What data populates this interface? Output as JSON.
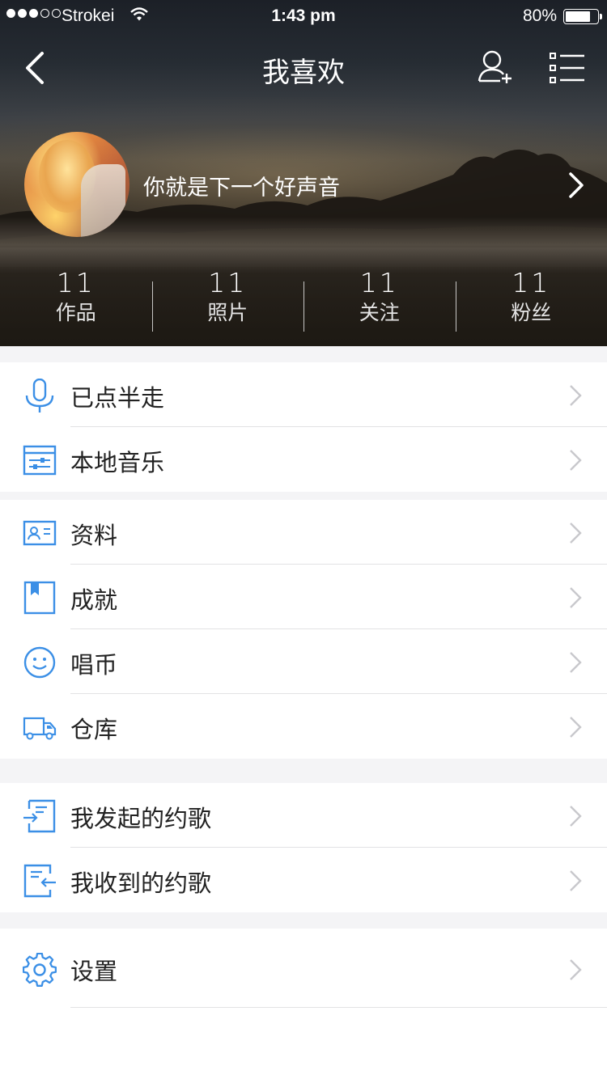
{
  "status_bar": {
    "carrier": "Strokei",
    "time": "1:43 pm",
    "battery": "80%",
    "battery_level": 0.8
  },
  "nav": {
    "title": "我喜欢"
  },
  "profile": {
    "name": "你就是下一个好声音"
  },
  "stats": [
    {
      "value": "11",
      "label": "作品"
    },
    {
      "value": "11",
      "label": "照片"
    },
    {
      "value": "11",
      "label": "关注"
    },
    {
      "value": "11",
      "label": "粉丝"
    }
  ],
  "groups": [
    [
      {
        "label": "已点半走",
        "icon": "microphone-icon"
      },
      {
        "label": "本地音乐",
        "icon": "local-music-icon"
      }
    ],
    [
      {
        "label": "资料",
        "icon": "profile-card-icon"
      },
      {
        "label": "成就",
        "icon": "bookmark-icon"
      },
      {
        "label": "唱币",
        "icon": "smiley-icon"
      },
      {
        "label": "仓库",
        "icon": "truck-icon"
      }
    ],
    [
      {
        "label": "我发起的约歌",
        "icon": "sent-invite-icon"
      },
      {
        "label": "我收到的约歌",
        "icon": "received-invite-icon"
      }
    ],
    [
      {
        "label": "设置",
        "icon": "gear-icon"
      }
    ]
  ],
  "colors": {
    "accent": "#3b8fe6",
    "text": "#222222",
    "divider": "#e2e2e4",
    "group_gap": "#f4f4f6",
    "chevron": "#c8c8cc"
  }
}
